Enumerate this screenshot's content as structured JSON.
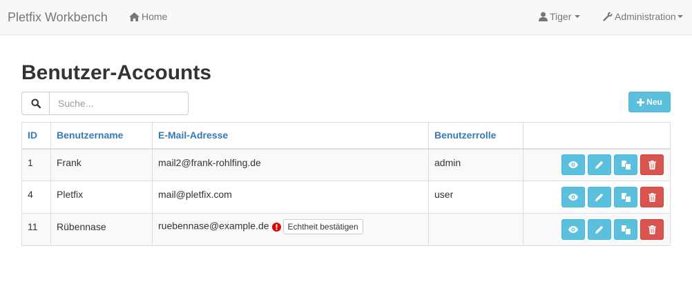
{
  "navbar": {
    "brand": "Pletfix Workbench",
    "home_label": "Home",
    "user_label": "Tiger",
    "admin_label": "Administration"
  },
  "page": {
    "title": "Benutzer-Accounts",
    "search_placeholder": "Suche...",
    "new_button_label": "Neu"
  },
  "table": {
    "headers": [
      "ID",
      "Benutzername",
      "E-Mail-Adresse",
      "Benutzerrolle",
      ""
    ],
    "rows": [
      {
        "id": "1",
        "name": "Frank",
        "email": "mail2@frank-rohlfing.de",
        "role": "admin",
        "unverified": false
      },
      {
        "id": "4",
        "name": "Pletfix",
        "email": "mail@pletfix.com",
        "role": "user",
        "unverified": false
      },
      {
        "id": "11",
        "name": "Rübennase",
        "email": "ruebennase@example.de",
        "role": "",
        "unverified": true,
        "verify_label": "Echtheit bestätigen"
      }
    ]
  },
  "colors": {
    "info": "#5bc0de",
    "danger": "#d9534f",
    "link": "#337ab7",
    "warning_icon": "#e00000"
  },
  "icons": {
    "home": "home-icon",
    "user": "user-icon",
    "admin": "wrench-icon",
    "search": "search-icon",
    "new": "plus-icon",
    "show": "eye-icon",
    "edit": "pencil-icon",
    "copy": "copy-icon",
    "delete": "trash-icon",
    "warning": "exclamation-icon"
  }
}
